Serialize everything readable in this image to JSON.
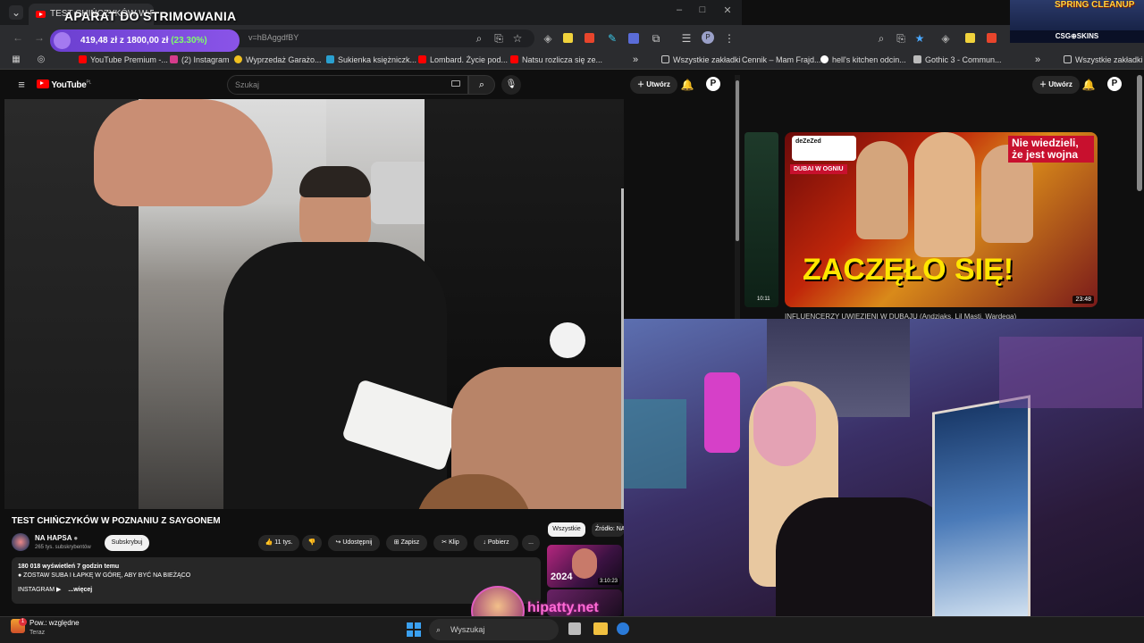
{
  "left_browser": {
    "tab_title": "TEST CHIŃCZYKÓW W PO...",
    "url_fragment": "v=hBAggdfBY",
    "window_controls": {
      "minimize": "–",
      "maximize": "□",
      "close": "✕"
    },
    "bookmarks": [
      {
        "label": "YouTube Premium -...",
        "color": "#ff0000"
      },
      {
        "label": "(2) Instagram",
        "color": "#d63c8c"
      },
      {
        "label": "Wyprzedaż Garażo...",
        "color": "#f0c020"
      },
      {
        "label": "Sukienka księżniczk...",
        "color": "#2aa0d0"
      },
      {
        "label": "Lombard. Życie pod...",
        "color": "#ff0000"
      },
      {
        "label": "Natsu rozlicza się ze...",
        "color": "#ff0000"
      }
    ],
    "all_bookmarks_label": "Wszystkie zakładki"
  },
  "youtube": {
    "logo": "YouTube",
    "logo_country": "PL",
    "search_placeholder": "Szukaj",
    "create_label": "Utwórz",
    "video_title": "TEST CHIŃCZYKÓW W POZNANIU Z SAYGONEM",
    "channel_name": "NA HAPSA",
    "channel_subs": "265 tys. subskrybentów",
    "subscribe_label": "Subskrybuj",
    "likes": "11 tys.",
    "share_label": "Udostępnij",
    "save_label": "Zapisz",
    "clip_label": "Klip",
    "download_label": "Pobierz",
    "more_label": "...",
    "views_line": "180 018 wyświetleń  7 godzin temu",
    "desc_line": "● ZOSTAW SUBA I ŁAPKĘ W GÓRĘ, ABY BYĆ NA BIEŻĄCO",
    "instagram_line": "INSTAGRAM ▶",
    "more_desc": "...więcej",
    "chip_all": "Wszystkie",
    "chip_source": "Źródło: NA",
    "side_thumb_year": "2024",
    "side_thumb_duration": "3:10:23"
  },
  "stream_overlay": {
    "title": "APARAT DO STRIMOWANIA",
    "price_text": "419,48 zł z 1800,00 zł",
    "percent_text": "(23.30%)",
    "progress_fraction": 0.233
  },
  "right_browser": {
    "bookmarks": [
      {
        "label": "Cennik – Mam Frajd...",
        "color": "#ffffff"
      },
      {
        "label": "hell's kitchen odcin...",
        "color": "#ffffff"
      },
      {
        "label": "Gothic 3 - Commun...",
        "color": "#ffffff"
      }
    ],
    "all_bookmarks_label": "Wszystkie zakładki",
    "create_label": "Utwórz",
    "thumb_main_text": "ZACZĘŁO SIĘ!",
    "thumb_corner_text": "Nie wiedzieli, że jest wojna",
    "thumb_badge": "DUBAI W OGNIU",
    "thumb_channel": "deZeZed",
    "thumb_duration": "23:48",
    "left_thumb_duration": "10:11",
    "video_title": "INFLUENCERZY UWIĘZIENI W DUBAJU (Andziaks, Lil Masti, Wardega)"
  },
  "sponsor": {
    "title": "SPRING CLEANUP",
    "brand": "CSG⊕SKINS"
  },
  "watermark": {
    "text": "hipatty.net"
  },
  "taskbar": {
    "weather_label": "Pow.: względne",
    "weather_sub": "Teraz",
    "search_placeholder": "Wyszukaj"
  }
}
